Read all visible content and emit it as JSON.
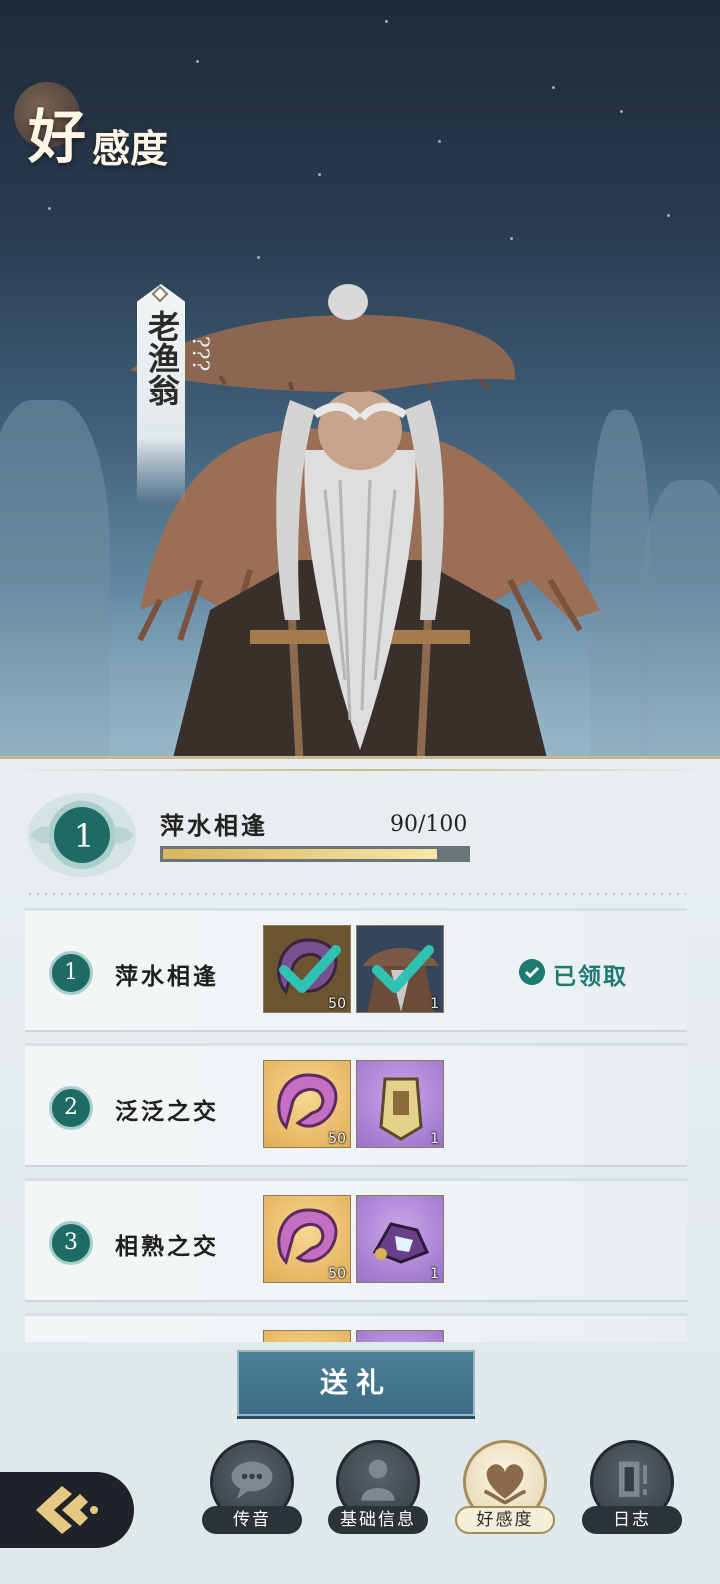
{
  "header": {
    "title_main": "好",
    "title_sub": "感度"
  },
  "character": {
    "name": "老渔翁",
    "unknown_marks": "???"
  },
  "affinity": {
    "level": "1",
    "level_name": "萍水相逢",
    "progress_text": "90/100",
    "progress_fraction": 0.9
  },
  "rewards": [
    {
      "index": "1",
      "title": "萍水相逢",
      "status": "已领取",
      "items": [
        {
          "icon": "jade-token-icon",
          "qty": "50",
          "claimed": true
        },
        {
          "icon": "fisherman-portrait-icon",
          "qty": "1",
          "claimed": true
        }
      ]
    },
    {
      "index": "2",
      "title": "泛泛之交",
      "items": [
        {
          "icon": "jade-token-icon",
          "qty": "50"
        },
        {
          "icon": "spirit-tablet-icon",
          "qty": "1"
        }
      ]
    },
    {
      "index": "3",
      "title": "相熟之交",
      "items": [
        {
          "icon": "jade-token-icon",
          "qty": "50"
        },
        {
          "icon": "lantern-charm-icon",
          "qty": "1"
        }
      ]
    }
  ],
  "actions": {
    "gift_label": "送礼"
  },
  "nav": [
    {
      "label": "传音",
      "icon": "chat-bubble-icon"
    },
    {
      "label": "基础信息",
      "icon": "person-bust-icon"
    },
    {
      "label": "好感度",
      "icon": "heart-icon",
      "active": true
    },
    {
      "label": "日志",
      "icon": "journal-icon"
    }
  ],
  "colors": {
    "accent_teal": "#1f7a72",
    "progress_gold": "#e7cd7f",
    "gift_button": "#3f6f88"
  }
}
